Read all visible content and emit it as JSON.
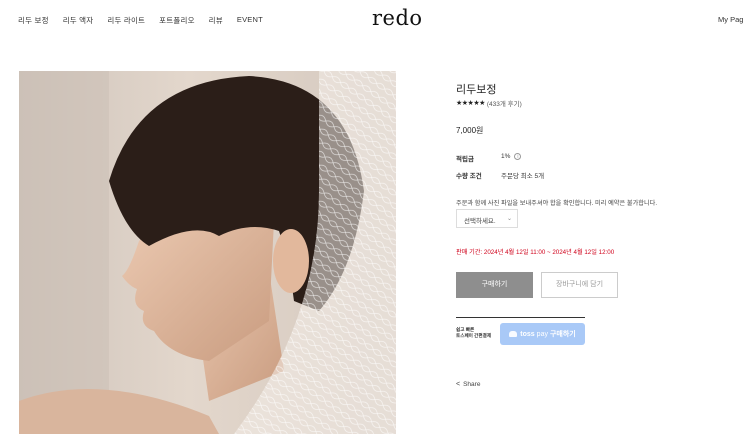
{
  "header": {
    "nav": [
      "리두 보정",
      "리두 액자",
      "리두 라이트",
      "포트폴리오",
      "리뷰",
      "EVENT"
    ],
    "logo": "redo",
    "mypage": "My Page"
  },
  "product": {
    "title": "리두보정",
    "stars": "★★★★★",
    "review_count": "(433개 후기)",
    "price": "7,000원",
    "points_label": "적립금",
    "points_value": "1%",
    "qty_label": "수량 조건",
    "qty_value": "주문당 최소 5개",
    "notice": "주문과 함께 사진 파일을 보내주셔야 합을 확인합니다. 미리 예약은 불가합니다.",
    "select_placeholder": "선택하세요.",
    "sale_period": "판매 기간: 2024년 4월 12일 11:00 ~ 2024년 4월 12일 12:00",
    "buy_label": "구매하기",
    "cart_label": "장바구니에 담기",
    "toss_label_line1": "쉽고 빠른",
    "toss_label_line2": "토스페이 간편결제",
    "toss_brand": "toss",
    "toss_pay": "pay",
    "toss_action": "구매하기",
    "share_label": "Share"
  },
  "colors": {
    "accent_red": "#d0021b",
    "buy_button": "#8e8e8e",
    "toss_button": "#a9c9f7"
  }
}
